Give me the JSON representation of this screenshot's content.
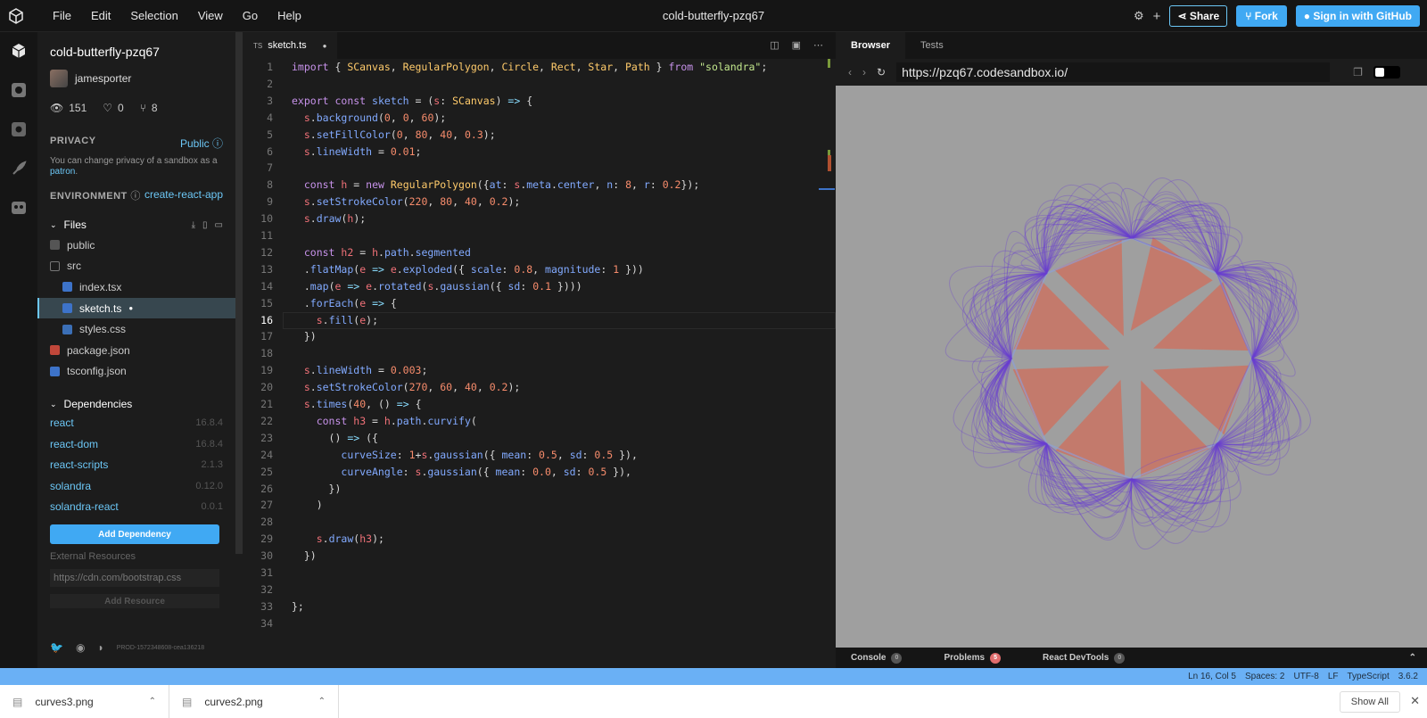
{
  "menu": [
    "File",
    "Edit",
    "Selection",
    "View",
    "Go",
    "Help"
  ],
  "window_title": "cold-butterfly-pzq67",
  "toolbar": {
    "share": "Share",
    "fork": "Fork",
    "signin": "Sign in with GitHub"
  },
  "sidebar": {
    "project": "cold-butterfly-pzq67",
    "author": "jamesporter",
    "views": "151",
    "likes": "0",
    "forks": "8",
    "privacy_label": "PRIVACY",
    "privacy_value": "Public",
    "privacy_note": "You can change privacy of a sandbox as a",
    "privacy_link": "patron",
    "env_label": "ENVIRONMENT",
    "env_value": "create-react-app",
    "files_label": "Files",
    "files": [
      {
        "name": "public",
        "type": "folder"
      },
      {
        "name": "src",
        "type": "folder-open"
      },
      {
        "name": "index.tsx",
        "type": "ts"
      },
      {
        "name": "sketch.ts",
        "type": "ts"
      },
      {
        "name": "styles.css",
        "type": "css"
      },
      {
        "name": "package.json",
        "type": "json"
      },
      {
        "name": "tsconfig.json",
        "type": "ts"
      }
    ],
    "deps_label": "Dependencies",
    "deps": [
      {
        "name": "react",
        "ver": "16.8.4"
      },
      {
        "name": "react-dom",
        "ver": "16.8.4"
      },
      {
        "name": "react-scripts",
        "ver": "2.1.3"
      },
      {
        "name": "solandra",
        "ver": "0.12.0"
      },
      {
        "name": "solandra-react",
        "ver": "0.0.1"
      }
    ],
    "add_dep": "Add Dependency",
    "ext_label": "External Resources",
    "ext_placeholder": "https://cdn.com/bootstrap.css",
    "add_res": "Add Resource",
    "version": "PROD-1572348608-cea136218"
  },
  "editor": {
    "tab": "sketch.ts",
    "tab_prefix": "TS",
    "line_numbers": [
      "1",
      "2",
      "3",
      "4",
      "5",
      "6",
      "7",
      "8",
      "9",
      "10",
      "11",
      "12",
      "13",
      "14",
      "15",
      "16",
      "17",
      "18",
      "19",
      "20",
      "21",
      "22",
      "23",
      "24",
      "25",
      "26",
      "27",
      "28",
      "29",
      "30",
      "31",
      "32",
      "33",
      "34"
    ]
  },
  "browser": {
    "tab_browser": "Browser",
    "tab_tests": "Tests",
    "url": "https://pzq67.codesandbox.io/",
    "console": "Console",
    "console_count": "0",
    "problems": "Problems",
    "problems_count": "5",
    "devtools": "React DevTools",
    "devtools_count": "0"
  },
  "status": [
    "Ln 16, Col 5",
    "Spaces: 2",
    "UTF-8",
    "LF",
    "TypeScript",
    "3.6.2"
  ],
  "downloads": [
    {
      "name": "curves3.png"
    },
    {
      "name": "curves2.png"
    }
  ],
  "show_all": "Show All",
  "colors": {
    "accent": "#40a9f3",
    "status": "#6ab0f5",
    "preview_bg": "#9f9f9f"
  }
}
